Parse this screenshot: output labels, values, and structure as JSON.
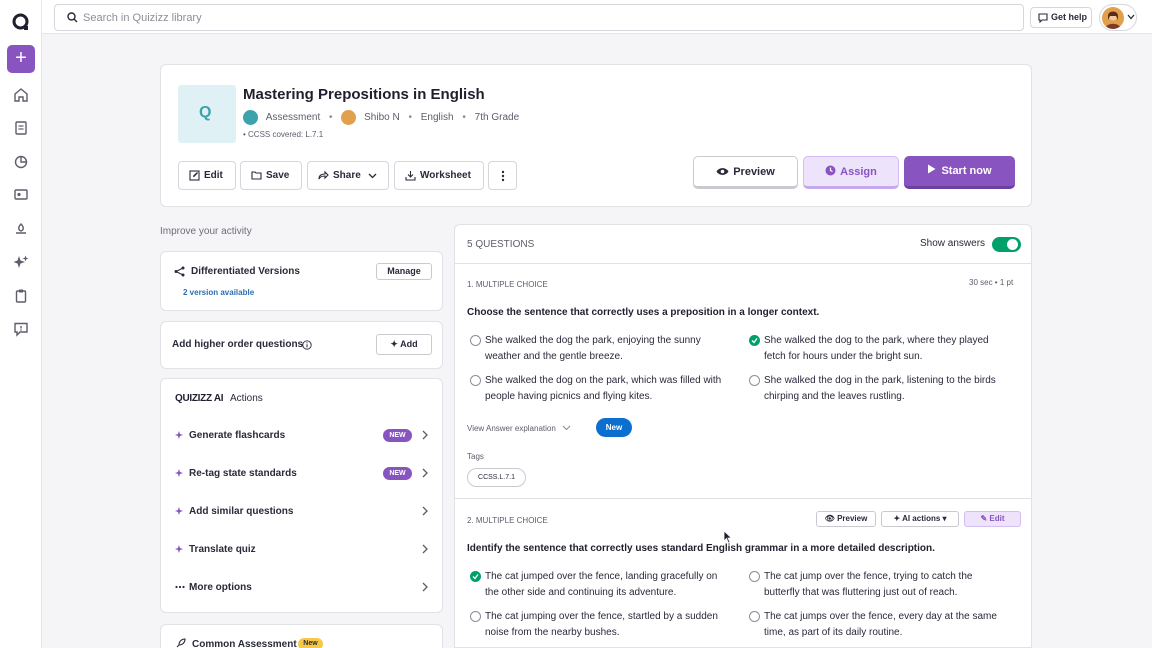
{
  "colors": {
    "brand": "#8854c0",
    "success": "#00a06b",
    "link": "#2a6fb3",
    "new_pill": "#0a6fcf"
  },
  "search": {
    "placeholder": "Search in Quizizz library"
  },
  "topbar": {
    "get_help": "Get help"
  },
  "quiz": {
    "title": "Mastering Prepositions in English",
    "type": "Assessment",
    "author": "Shibo N",
    "subject": "English",
    "grade": "7th Grade",
    "ccss": "• CCSS covered:  L.7.1"
  },
  "header_buttons": {
    "edit": "Edit",
    "save": "Save",
    "share": "Share",
    "worksheet": "Worksheet",
    "preview": "Preview",
    "assign": "Assign",
    "start": "Start now"
  },
  "improve": {
    "heading": "Improve your activity",
    "differentiated": {
      "title": "Differentiated Versions",
      "button": "Manage",
      "link": "2 version available"
    },
    "higher_order": {
      "title": "Add higher order questions",
      "button": "Add"
    },
    "ai": {
      "brand": "QUIZIZZ AI",
      "title": "Actions",
      "actions": [
        {
          "label": "Generate flashcards",
          "badge": "NEW"
        },
        {
          "label": "Re-tag state standards",
          "badge": "NEW"
        },
        {
          "label": "Add similar questions"
        },
        {
          "label": "Translate quiz"
        },
        {
          "label": "More options"
        }
      ]
    },
    "common": {
      "title": "Common Assessment",
      "badge": "New"
    }
  },
  "questions": {
    "count_label": "5 QUESTIONS",
    "show_answers": "Show answers",
    "q1": {
      "header": "1. MULTIPLE CHOICE",
      "meta": "30 sec  •  1 pt",
      "text": "Choose the sentence that correctly uses a preposition in a longer context.",
      "options": [
        "She walked the dog the park, enjoying the sunny weather and the gentle breeze.",
        "She walked the dog to the park, where they played fetch for hours under the bright sun.",
        "She walked the dog on the park, which was filled with people having picnics and flying kites.",
        "She walked the dog in the park, listening to the birds chirping and the leaves rustling."
      ],
      "view_explanation": "View Answer explanation",
      "new_label": "New",
      "tags_label": "Tags",
      "tag": "CCSS.L.7.1"
    },
    "q2": {
      "header": "2. MULTIPLE CHOICE",
      "preview": "Preview",
      "ai_actions": "AI actions",
      "edit": "Edit",
      "text": "Identify the sentence that correctly uses standard English grammar in a more detailed description.",
      "options": [
        "The cat jumped over the fence, landing gracefully on the other side and continuing its adventure.",
        "The cat jump over the fence, trying to catch the butterfly that was fluttering just out of reach.",
        "The cat jumping over the fence, startled by a sudden noise from the nearby bushes.",
        "The cat jumps over the fence, every day at the same time, as part of its daily routine."
      ]
    }
  }
}
